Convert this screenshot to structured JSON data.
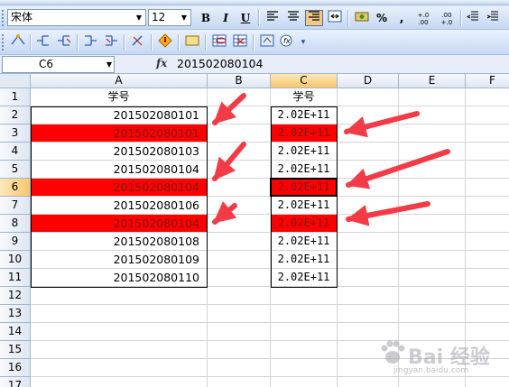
{
  "toolbar": {
    "font_name": "宋体",
    "font_size": "12",
    "bold_label": "B",
    "italic_label": "I",
    "underline_label": "U",
    "percent_label": "%",
    "comma_label": ",",
    "inc_decimal_label": "+.0 .00",
    "dec_decimal_label": ".00 +.0"
  },
  "formula_bar": {
    "name_box": "C6",
    "fx_label": "fx",
    "content": "201502080104"
  },
  "sheet": {
    "columns": [
      "A",
      "B",
      "C",
      "D",
      "E",
      "F"
    ],
    "selected_column": "C",
    "rows": [
      "1",
      "2",
      "3",
      "4",
      "5",
      "6",
      "7",
      "8",
      "9",
      "10",
      "11",
      "12",
      "13",
      "14",
      "15",
      "16",
      "17"
    ],
    "selected_row": "6",
    "col_a": {
      "header": "学号",
      "values": [
        "201502080101",
        "201502080101",
        "201502080103",
        "201502080104",
        "201502080104",
        "201502080106",
        "201502080104",
        "201502080108",
        "201502080109",
        "201502080110"
      ]
    },
    "col_c": {
      "header": "学号",
      "values": [
        "2.02E+11",
        "2.02E+11",
        "2.02E+11",
        "2.02E+11",
        "2.02E+11",
        "2.02E+11",
        "2.02E+11",
        "2.02E+11",
        "2.02E+11",
        "2.02E+11"
      ]
    },
    "highlight_rows": [
      "3",
      "6",
      "8"
    ]
  },
  "colors": {
    "highlight": "#fe0000",
    "arrow": "#f23b46",
    "selection_header": "#f8c66b"
  },
  "watermark": {
    "text": "Bai 经验",
    "sub": "jingyan.baidu.com"
  }
}
